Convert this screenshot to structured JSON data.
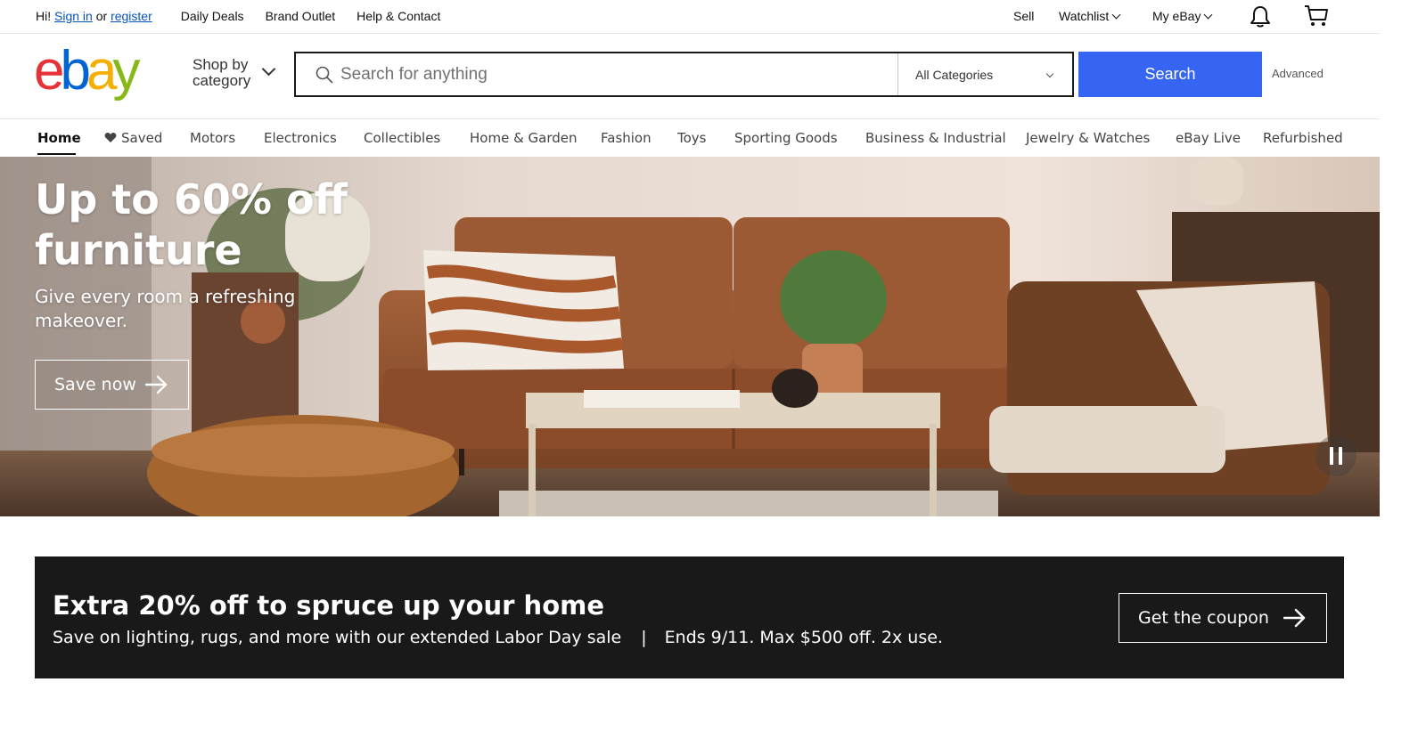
{
  "topbar": {
    "greeting_prefix": "Hi!",
    "sign_in": "Sign in",
    "or": "or",
    "register": "register",
    "links": [
      "Daily Deals",
      "Brand Outlet",
      "Help & Contact"
    ],
    "sell": "Sell",
    "watchlist": "Watchlist",
    "my_ebay": "My eBay"
  },
  "header": {
    "logo_text": "ebay",
    "logo_colors": [
      "#e53238",
      "#0064d2",
      "#f5af02",
      "#86b817"
    ],
    "shop_by_line1": "Shop by",
    "shop_by_line2": "category",
    "search_placeholder": "Search for anything",
    "category_selected": "All Categories",
    "search_button": "Search",
    "advanced": "Advanced",
    "accent_color": "#3665f3"
  },
  "nav": {
    "items": [
      "Home",
      "Saved",
      "Motors",
      "Electronics",
      "Collectibles",
      "Home & Garden",
      "Fashion",
      "Toys",
      "Sporting Goods",
      "Business & Industrial",
      "Jewelry & Watches",
      "eBay Live",
      "Refurbished"
    ],
    "active": "Home"
  },
  "hero": {
    "headline": "Up to 60% off furniture",
    "subtitle": "Give every room a refreshing makeover.",
    "cta": "Save now"
  },
  "promo": {
    "title": "Extra 20% off to spruce up your home",
    "description": "Save on lighting, rugs, and more with our extended Labor Day sale",
    "separator": "|",
    "terms": "Ends 9/11. Max $500 off. 2x use.",
    "cta": "Get the coupon"
  }
}
